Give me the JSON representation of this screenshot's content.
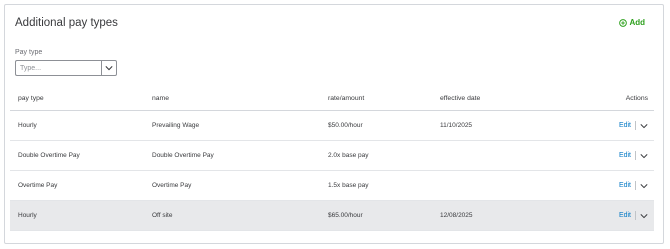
{
  "section": {
    "title": "Additional pay types",
    "add_label": "Add"
  },
  "filter": {
    "label": "Pay type",
    "placeholder": "Type..."
  },
  "table": {
    "headers": {
      "pay_type": "pay type",
      "name": "name",
      "rate": "rate/amount",
      "date": "effective date",
      "actions": "Actions"
    },
    "rows": [
      {
        "pay_type": "Hourly",
        "name": "Prevailing Wage",
        "rate": "$50.00/hour",
        "date": "11/10/2025",
        "action": "Edit"
      },
      {
        "pay_type": "Double Overtime Pay",
        "name": "Double Overtime Pay",
        "rate": "2.0x base pay",
        "date": "",
        "action": "Edit"
      },
      {
        "pay_type": "Overtime Pay",
        "name": "Overtime Pay",
        "rate": "1.5x base pay",
        "date": "",
        "action": "Edit"
      },
      {
        "pay_type": "Hourly",
        "name": "Off site",
        "rate": "$65.00/hour",
        "date": "12/08/2025",
        "action": "Edit"
      }
    ]
  },
  "colors": {
    "accent_green": "#2ca01c",
    "link_blue": "#0077c5",
    "row_highlight": "#e8e9eb"
  }
}
